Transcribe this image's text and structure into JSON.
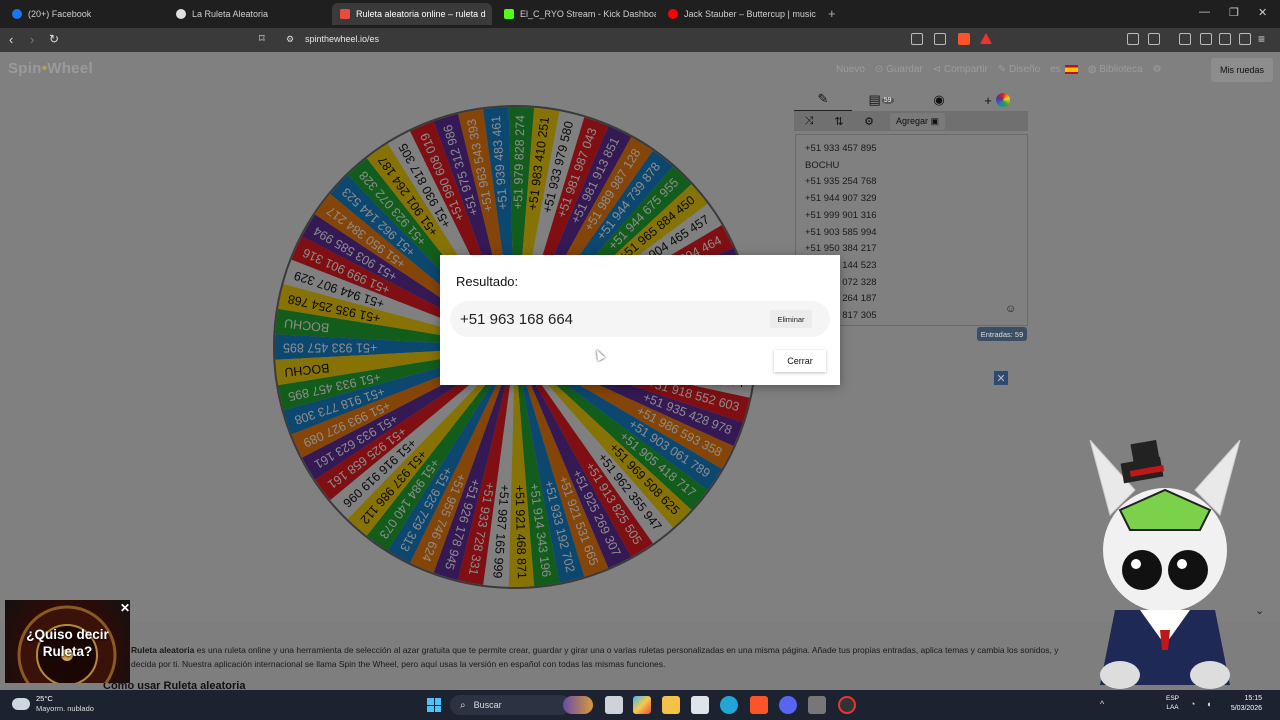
{
  "browser": {
    "tabs": [
      {
        "label": "(20+) Facebook",
        "color": "#1877f2"
      },
      {
        "label": "La Ruleta Aleatoria",
        "color": "#e0e0e0"
      },
      {
        "label": "Ruleta aleatoria online – ruleta d",
        "color": "#e74c3c",
        "active": true
      },
      {
        "label": "El_C_RYO Stream - Kick Dashboard",
        "color": "#53fc18"
      },
      {
        "label": "Jack Stauber – Buttercup | music",
        "color": "#ff0000"
      }
    ],
    "url": "spinthewheel.io/es"
  },
  "header": {
    "logo_part1": "Spin",
    "logo_part2": "Wheel",
    "menu": {
      "nuevo": "Nuevo",
      "guardar": "Guardar",
      "compartir": "Compartir",
      "diseno": "Diseño",
      "lang": "es",
      "biblioteca": "Biblioteca"
    },
    "mis_ruedas": "Mis ruedas"
  },
  "editor": {
    "badge": "59",
    "agregar": "Agregar",
    "entries": [
      "+51 933 457 895",
      "BOCHU",
      "+51 935 254 768",
      "+51 944 907 329",
      "+51 999 901 316",
      "+51 903 585 994",
      "+51 950 384 217",
      "+51 962 144 523",
      "+51 923 072 328",
      "+51 901 264 187",
      "+51 930 817 305"
    ],
    "entradas": "Entradas: 59"
  },
  "wheel": {
    "colors": [
      "#1e7fc4",
      "#2aa43a",
      "#f2d11a",
      "#e8e8e8",
      "#d81f26",
      "#5c2f93",
      "#e87d1a"
    ],
    "labels": [
      "+51 933 457 895",
      "BOCHU",
      "+51 935 254 768",
      "+51 944 907 329",
      "+51 999 901 316",
      "+51 903 585 994",
      "+51 950 384 217",
      "+51 962 144 523",
      "+51 923 072 328",
      "+51 901 264 187",
      "+51 930 817 305",
      "+51 990 608 019",
      "+51 975 312 986",
      "+51 963 543 393",
      "+51 939 483 461",
      "+51 979 828 274",
      "+51 983 410 251",
      "+51 933 979 580",
      "+51 981 987 043",
      "+51 981 913 851",
      "+51 989 987 128",
      "+51 944 739 878",
      "+51 944 675 955",
      "+51 965 884 450",
      "+51 904 465 457",
      "+51 947 994 464",
      "+51 950 671 615",
      "+51 965 703 262",
      "+51 918 747",
      "+51 943 210 558",
      "+51 927 458 112",
      "+51 966 301 774",
      "+51 918 552 603",
      "+51 935 428 978",
      "+51 986 593 358",
      "+51 903 061 789",
      "+51 905 418 717",
      "+51 969 508 625",
      "+51 962 355 947",
      "+51 913 825 505",
      "+51 925 269 307",
      "+51 921 531 665",
      "+51 933 192 702",
      "+51 914 343 196",
      "+51 921 468 871",
      "+51 987 165 999",
      "+51 933 728 331",
      "+51 926 178 945",
      "+51 955 746 624",
      "+51 925 729 313",
      "+51 984 140 073",
      "+51 937 986 112",
      "+51 916 919 096",
      "+51 925 658 161",
      "+51 933 623 161",
      "+51 993 927 089",
      "+51 918 773 308",
      "+51 933 457 895",
      "BOCHU"
    ]
  },
  "modal": {
    "title": "Resultado:",
    "result": "+51 963 168 664",
    "eliminar": "Eliminar",
    "cerrar": "Cerrar"
  },
  "description": {
    "line1_bold": "Ruleta aleatoria",
    "line1": " es una ruleta online y una herramienta de selección al azar gratuita que te permite crear, guardar y girar una o varias ruletas personalizadas en una misma página. Añade tus propias entradas, aplica temas y cambia los sonidos, y",
    "line2": "decida por ti. Nuestra aplicación internacional se llama Spin the Wheel, pero aquí usas la versión en español con todas las mismas funciones.",
    "heading": "Cómo usar Ruleta aleatoria"
  },
  "promo": {
    "text": "¿Quiso decir Ruleta?"
  },
  "taskbar": {
    "temp": "25°C",
    "weather": "Mayorm. nublado",
    "search": "Buscar",
    "lang1": "ESP",
    "lang2": "LAA",
    "time": "15:15",
    "date": "5/03/2026"
  }
}
